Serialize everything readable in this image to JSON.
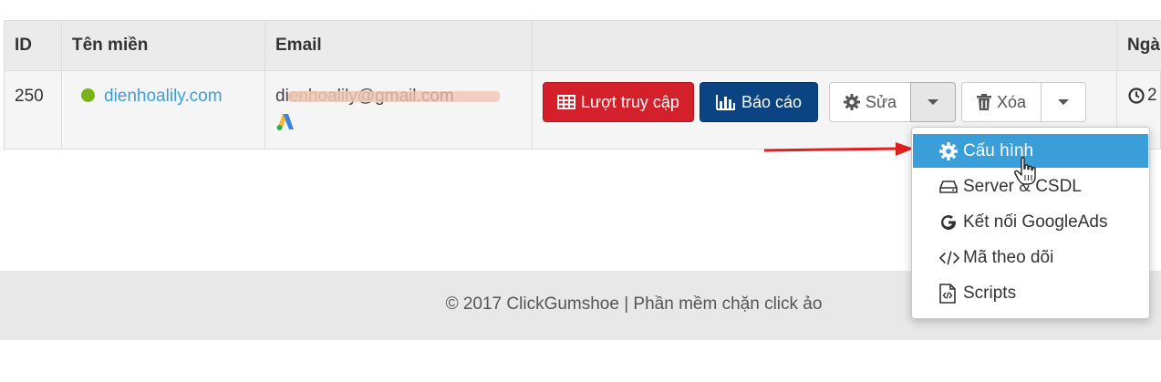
{
  "table": {
    "headers": [
      "ID",
      "Tên miền",
      "Email",
      "",
      "Ngà"
    ],
    "row": {
      "id": "250",
      "domain": "dienhoalily.com",
      "email": "dienhoalily@gmail.com",
      "status_color": "#7ab317"
    }
  },
  "actions": {
    "visits_label": "Lượt truy cập",
    "report_label": "Báo cáo",
    "edit_label": "Sửa",
    "delete_label": "Xóa",
    "date_partial": "2"
  },
  "dropdown": {
    "items": [
      {
        "label": "Cấu hình",
        "icon": "gear-icon",
        "active": true
      },
      {
        "label": "Server & CSDL",
        "icon": "hdd-icon",
        "active": false
      },
      {
        "label": "Kết nối GoogleAds",
        "icon": "google-icon",
        "active": false
      },
      {
        "label": "Mã theo dõi",
        "icon": "code-icon",
        "active": false
      },
      {
        "label": "Scripts",
        "icon": "file-code-icon",
        "active": false
      }
    ]
  },
  "footer": {
    "text": "© 2017 ClickGumshoe | Phần mềm chặn click ảo"
  },
  "colors": {
    "accent": "#3a9ed8",
    "danger": "#d3202a",
    "primary_dark": "#0c4383",
    "annotation_arrow": "#e02020"
  }
}
